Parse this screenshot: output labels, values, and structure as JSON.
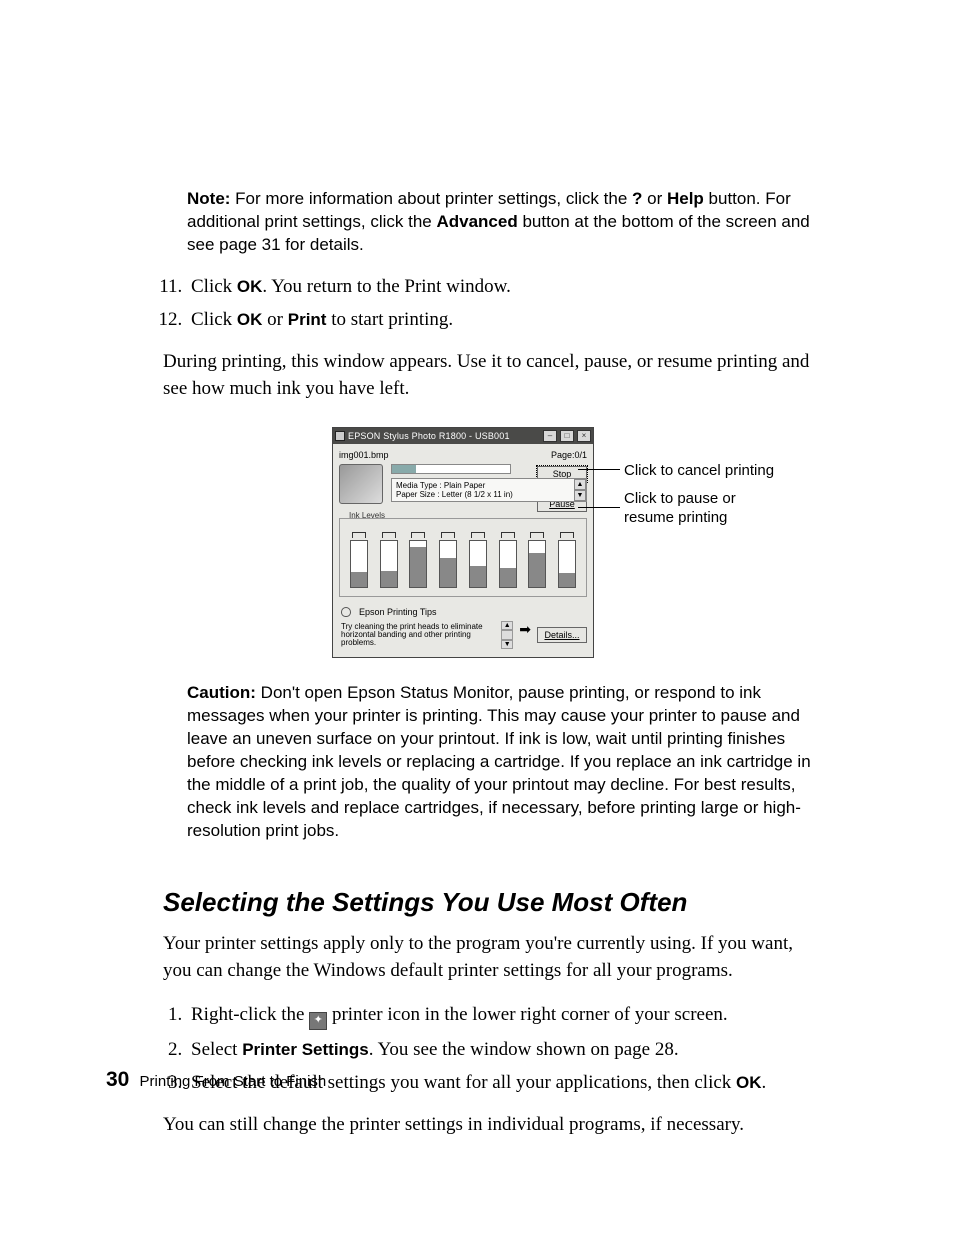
{
  "note": {
    "label": "Note:",
    "text_a": " For more information about printer settings, click the ",
    "q": "?",
    "or": " or ",
    "help": "Help",
    "text_b": " button. For additional print settings, click the ",
    "adv": "Advanced",
    "text_c": " button at the bottom of the screen and see page 31 for details."
  },
  "steps_a": {
    "s11_a": "Click ",
    "s11_ok": "OK",
    "s11_b": ". You return to the Print window.",
    "s12_a": "Click ",
    "s12_ok": "OK",
    "s12_or": " or ",
    "s12_print": "Print",
    "s12_b": " to start printing."
  },
  "para1": "During printing, this window appears. Use it to cancel, pause, or resume printing and see how much ink you have left.",
  "screenshot": {
    "title": "EPSON Stylus Photo R1800 - USB001",
    "file": "img001.bmp",
    "page": "Page:0/1",
    "media_line1": "Media Type : Plain Paper",
    "media_line2": "Paper Size : Letter (8 1/2 x 11 in)",
    "stop": "Stop",
    "pause": "Pause",
    "ink_label": "Ink Levels",
    "tips_label": "Epson Printing Tips",
    "tip_text": "Try cleaning the print heads to eliminate horizontal banding and other printing problems.",
    "details": "Details..."
  },
  "callouts": {
    "c1": "Click to cancel printing",
    "c2": "Click to pause or resume printing"
  },
  "caution": {
    "label": "Caution:",
    "text": " Don't open Epson Status Monitor, pause printing, or respond to ink messages when your printer is printing. This may cause your printer to pause and leave an uneven surface on your printout. If ink is low, wait until printing finishes before checking ink levels or replacing a cartridge. If you replace an ink cartridge in the middle of a print job, the quality of your printout may decline. For best results, check ink levels and replace cartridges, if necessary, before printing large or high-resolution print jobs."
  },
  "heading": "Selecting the Settings You Use Most Often",
  "para2": "Your printer settings apply only to the program you're currently using. If you want, you can change the Windows default printer settings for all your programs.",
  "steps_b": {
    "s1_a": "Right-click the ",
    "s1_b": " printer icon in the lower right corner of your screen.",
    "s2_a": "Select ",
    "s2_ps": "Printer Settings",
    "s2_b": ". You see the window shown on page 28.",
    "s3_a": "Select the default settings you want for all your applications, then click ",
    "s3_ok": "OK",
    "s3_b": "."
  },
  "para3": "You can still change the printer settings in individual programs, if necessary.",
  "footer": {
    "page": "30",
    "chapter": "Printing From Start to Finish"
  }
}
